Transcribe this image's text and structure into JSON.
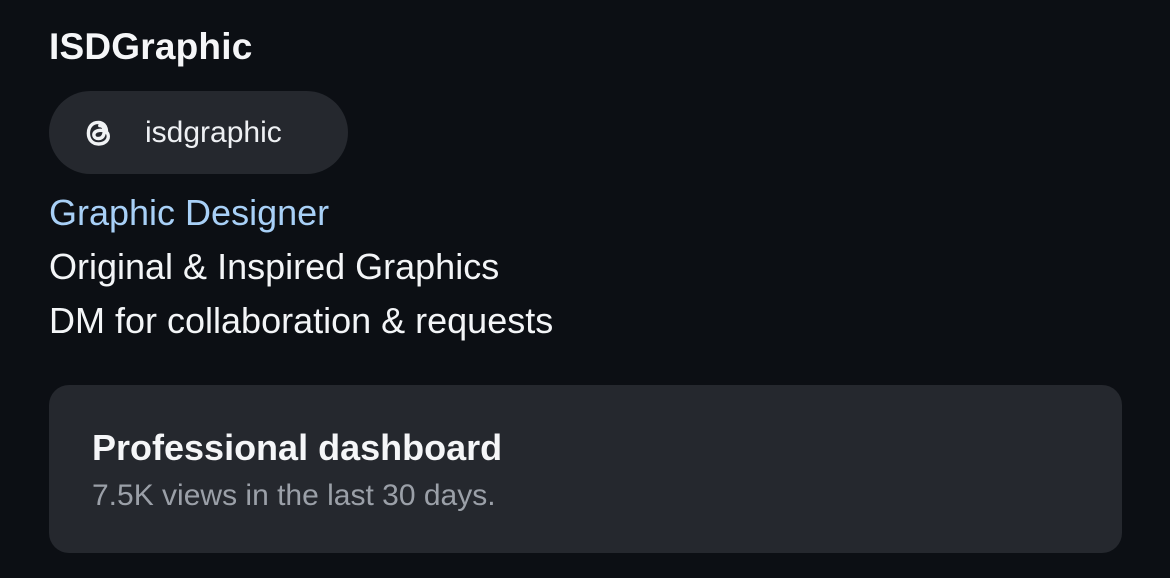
{
  "profile": {
    "name": "ISDGraphic",
    "threads_handle": "isdgraphic",
    "threads_icon": "threads-logo-icon",
    "category": "Graphic Designer",
    "bio": [
      "Original & Inspired Graphics",
      "DM for collaboration & requests"
    ]
  },
  "dashboard": {
    "title": "Professional dashboard",
    "subtitle": "7.5K views in the last 30 days."
  },
  "colors": {
    "background": "#0c0f14",
    "card": "#25282e",
    "category_link": "#a8d0f7",
    "muted_text": "#9ba0a8"
  }
}
